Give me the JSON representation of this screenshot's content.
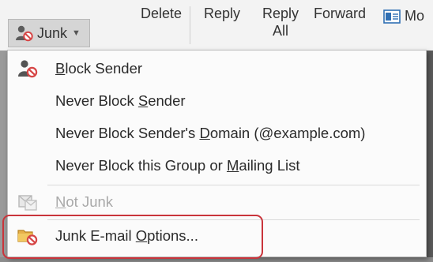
{
  "ribbon": {
    "junk_label": "Junk",
    "delete_label": "Delete",
    "reply_label": "Reply",
    "reply_all_line1": "Reply",
    "reply_all_line2": "All",
    "forward_label": "Forward",
    "move_label": "Mo"
  },
  "menu": {
    "items": [
      {
        "label_parts": [
          "",
          "B",
          "lock Sender"
        ],
        "icon": "block-sender-icon",
        "enabled": true
      },
      {
        "label_parts": [
          "Never Block ",
          "S",
          "ender"
        ],
        "icon": "",
        "enabled": true
      },
      {
        "label_parts": [
          "Never Block Sender's ",
          "D",
          "omain (@example.com)"
        ],
        "icon": "",
        "enabled": true
      },
      {
        "label_parts": [
          "Never Block this Group or ",
          "M",
          "ailing List"
        ],
        "icon": "",
        "enabled": true
      },
      {
        "label_parts": [
          "",
          "N",
          "ot Junk"
        ],
        "icon": "not-junk-icon",
        "enabled": false
      },
      {
        "label_parts": [
          "Junk E-mail ",
          "O",
          "ptions..."
        ],
        "icon": "junk-options-icon",
        "enabled": true
      }
    ]
  },
  "colors": {
    "highlight": "#c9343b",
    "block_red": "#d64545"
  }
}
